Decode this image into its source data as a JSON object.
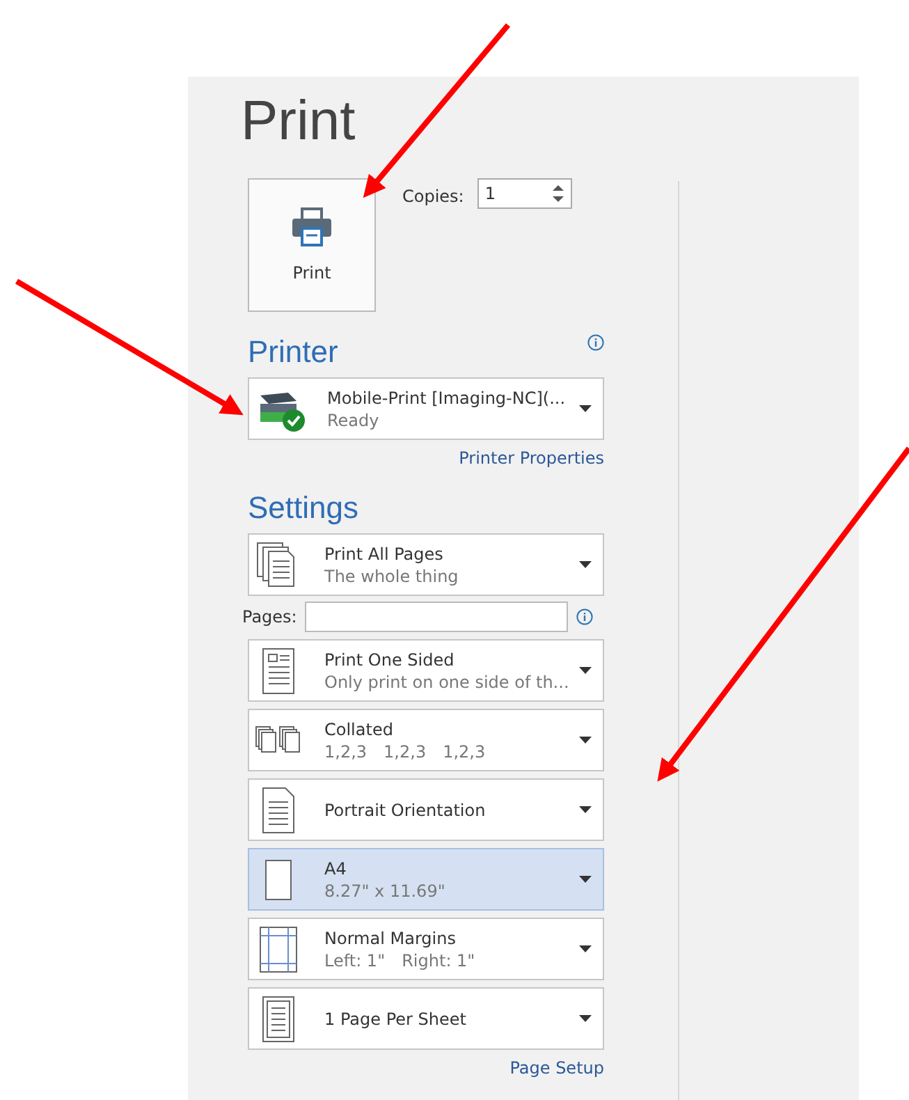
{
  "title": "Print",
  "print_button": {
    "label": "Print"
  },
  "copies": {
    "label": "Copies:",
    "value": "1"
  },
  "printer": {
    "heading": "Printer",
    "name": "Mobile-Print [Imaging-NC](...",
    "status": "Ready",
    "properties_link": "Printer Properties"
  },
  "settings": {
    "heading": "Settings",
    "options": [
      {
        "kind": "pages",
        "title": "Print All Pages",
        "subtitle": [
          "The whole thing"
        ],
        "selected": false
      },
      {
        "kind": "sided",
        "title": "Print One Sided",
        "subtitle": [
          "Only print on one side of th..."
        ],
        "selected": false
      },
      {
        "kind": "collated",
        "title": "Collated",
        "subtitle": [
          "1,2,3",
          "1,2,3",
          "1,2,3"
        ],
        "selected": false
      },
      {
        "kind": "orientation",
        "title": "Portrait Orientation",
        "selected": false
      },
      {
        "kind": "paper",
        "title": "A4",
        "subtitle": [
          "8.27\" x 11.69\""
        ],
        "selected": true
      },
      {
        "kind": "margins",
        "title": "Normal Margins",
        "subtitle": [
          "Left:  1\"",
          "Right:  1\""
        ],
        "selected": false
      },
      {
        "kind": "sheet",
        "title": "1 Page Per Sheet",
        "selected": false
      }
    ],
    "pages_field": {
      "label": "Pages:"
    },
    "page_setup_link": "Page Setup"
  }
}
